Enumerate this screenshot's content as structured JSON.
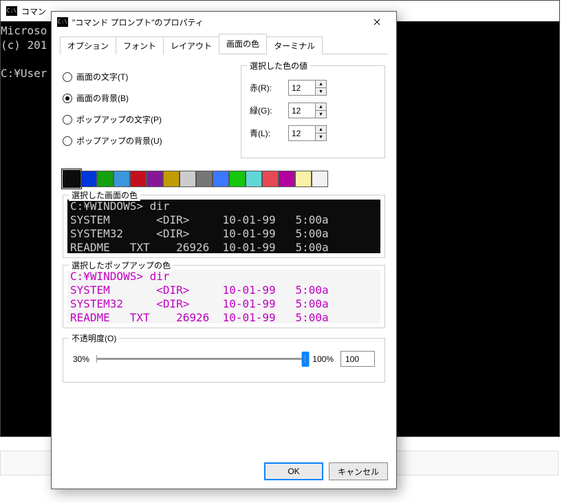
{
  "bg_console": {
    "title": "コマン",
    "lines": "Microso\n(c) 201\n\nC:¥User"
  },
  "dialog": {
    "title": "\"コマンド プロンプト\"のプロパティ",
    "tabs": [
      "オプション",
      "フォント",
      "レイアウト",
      "画面の色",
      "ターミナル"
    ],
    "active_tab": 3,
    "radios": [
      {
        "label": "画面の文字(T)",
        "selected": false
      },
      {
        "label": "画面の背景(B)",
        "selected": true
      },
      {
        "label": "ポップアップの文字(P)",
        "selected": false
      },
      {
        "label": "ポップアップの背景(U)",
        "selected": false
      }
    ],
    "rgb_group": {
      "legend": "選択した色の値",
      "red": {
        "label": "赤(R):",
        "value": "12"
      },
      "green": {
        "label": "緑(G):",
        "value": "12"
      },
      "blue": {
        "label": "青(L):",
        "value": "12"
      }
    },
    "palette": [
      "#0c0c0c",
      "#0037da",
      "#13a10e",
      "#3a96dd",
      "#c50f1f",
      "#881798",
      "#c19c00",
      "#cccccc",
      "#767676",
      "#3b78ff",
      "#16c60c",
      "#61d6d6",
      "#e74856",
      "#b4009e",
      "#f9f1a5",
      "#f2f2f2"
    ],
    "screen_preview": {
      "legend": "選択した画面の色",
      "text": "C:¥WINDOWS> dir\nSYSTEM       <DIR>     10-01-99   5:00a\nSYSTEM32     <DIR>     10-01-99   5:00a\nREADME   TXT    26926  10-01-99   5:00a"
    },
    "popup_preview": {
      "legend": "選択したポップアップの色",
      "text": "C:¥WINDOWS> dir\nSYSTEM       <DIR>     10-01-99   5:00a\nSYSTEM32     <DIR>     10-01-99   5:00a\nREADME   TXT    26926  10-01-99   5:00a"
    },
    "opacity": {
      "legend": "不透明度(O)",
      "min_label": "30%",
      "max_label": "100%",
      "value": "100",
      "percent": 100
    },
    "buttons": {
      "ok": "OK",
      "cancel": "キャンセル"
    }
  }
}
